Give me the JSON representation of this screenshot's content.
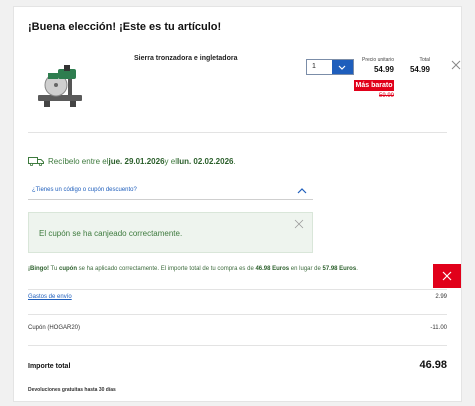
{
  "header": {
    "title": "¡Buena elección! ¡Este es tu artículo!"
  },
  "product": {
    "name": "Sierra tronzadora e ingletadora",
    "quantity": "1",
    "unit_price_label": "Precio unitario",
    "unit_price": "54.99",
    "badge": "Más barato",
    "old_price": "59.99",
    "total_label": "Total",
    "total_price": "54.99"
  },
  "delivery": {
    "prefix": "Recíbelo entre el ",
    "date1": "jue. 29.01.2026",
    "middle": " y el ",
    "date2": "lun. 02.02.2026",
    "suffix": "."
  },
  "coupon": {
    "toggle_label": "¿Tienes un código o cupón descuento?",
    "success_message": "El cupón se ha canjeado correctamente."
  },
  "bingo": {
    "strong1": "¡Bingo!",
    "text1": " Tu ",
    "strong2": "cupón",
    "text2": " se ha aplicado correctamente. El importe total de tu compra es de ",
    "strong3": "46.98 Euros",
    "text3": " en lugar de ",
    "strong4": "57.98 Euros",
    "text4": "."
  },
  "summary": {
    "shipping_label": "Gastos de envío",
    "shipping_value": "2.99",
    "coupon_label": "Cupón (HOGAR20)",
    "coupon_value": "-11.00",
    "total_label": "Importe total",
    "total_value": "46.98",
    "returns_note": "Devoluciones gratuitas hasta 30 días"
  },
  "colors": {
    "accent_blue": "#1e5ebc",
    "sale_red": "#e1001a",
    "success_green": "#3d7a3d"
  },
  "icons": [
    "saw-product-image",
    "chevron-down-icon",
    "close-icon",
    "truck-icon",
    "chevron-up-icon"
  ]
}
